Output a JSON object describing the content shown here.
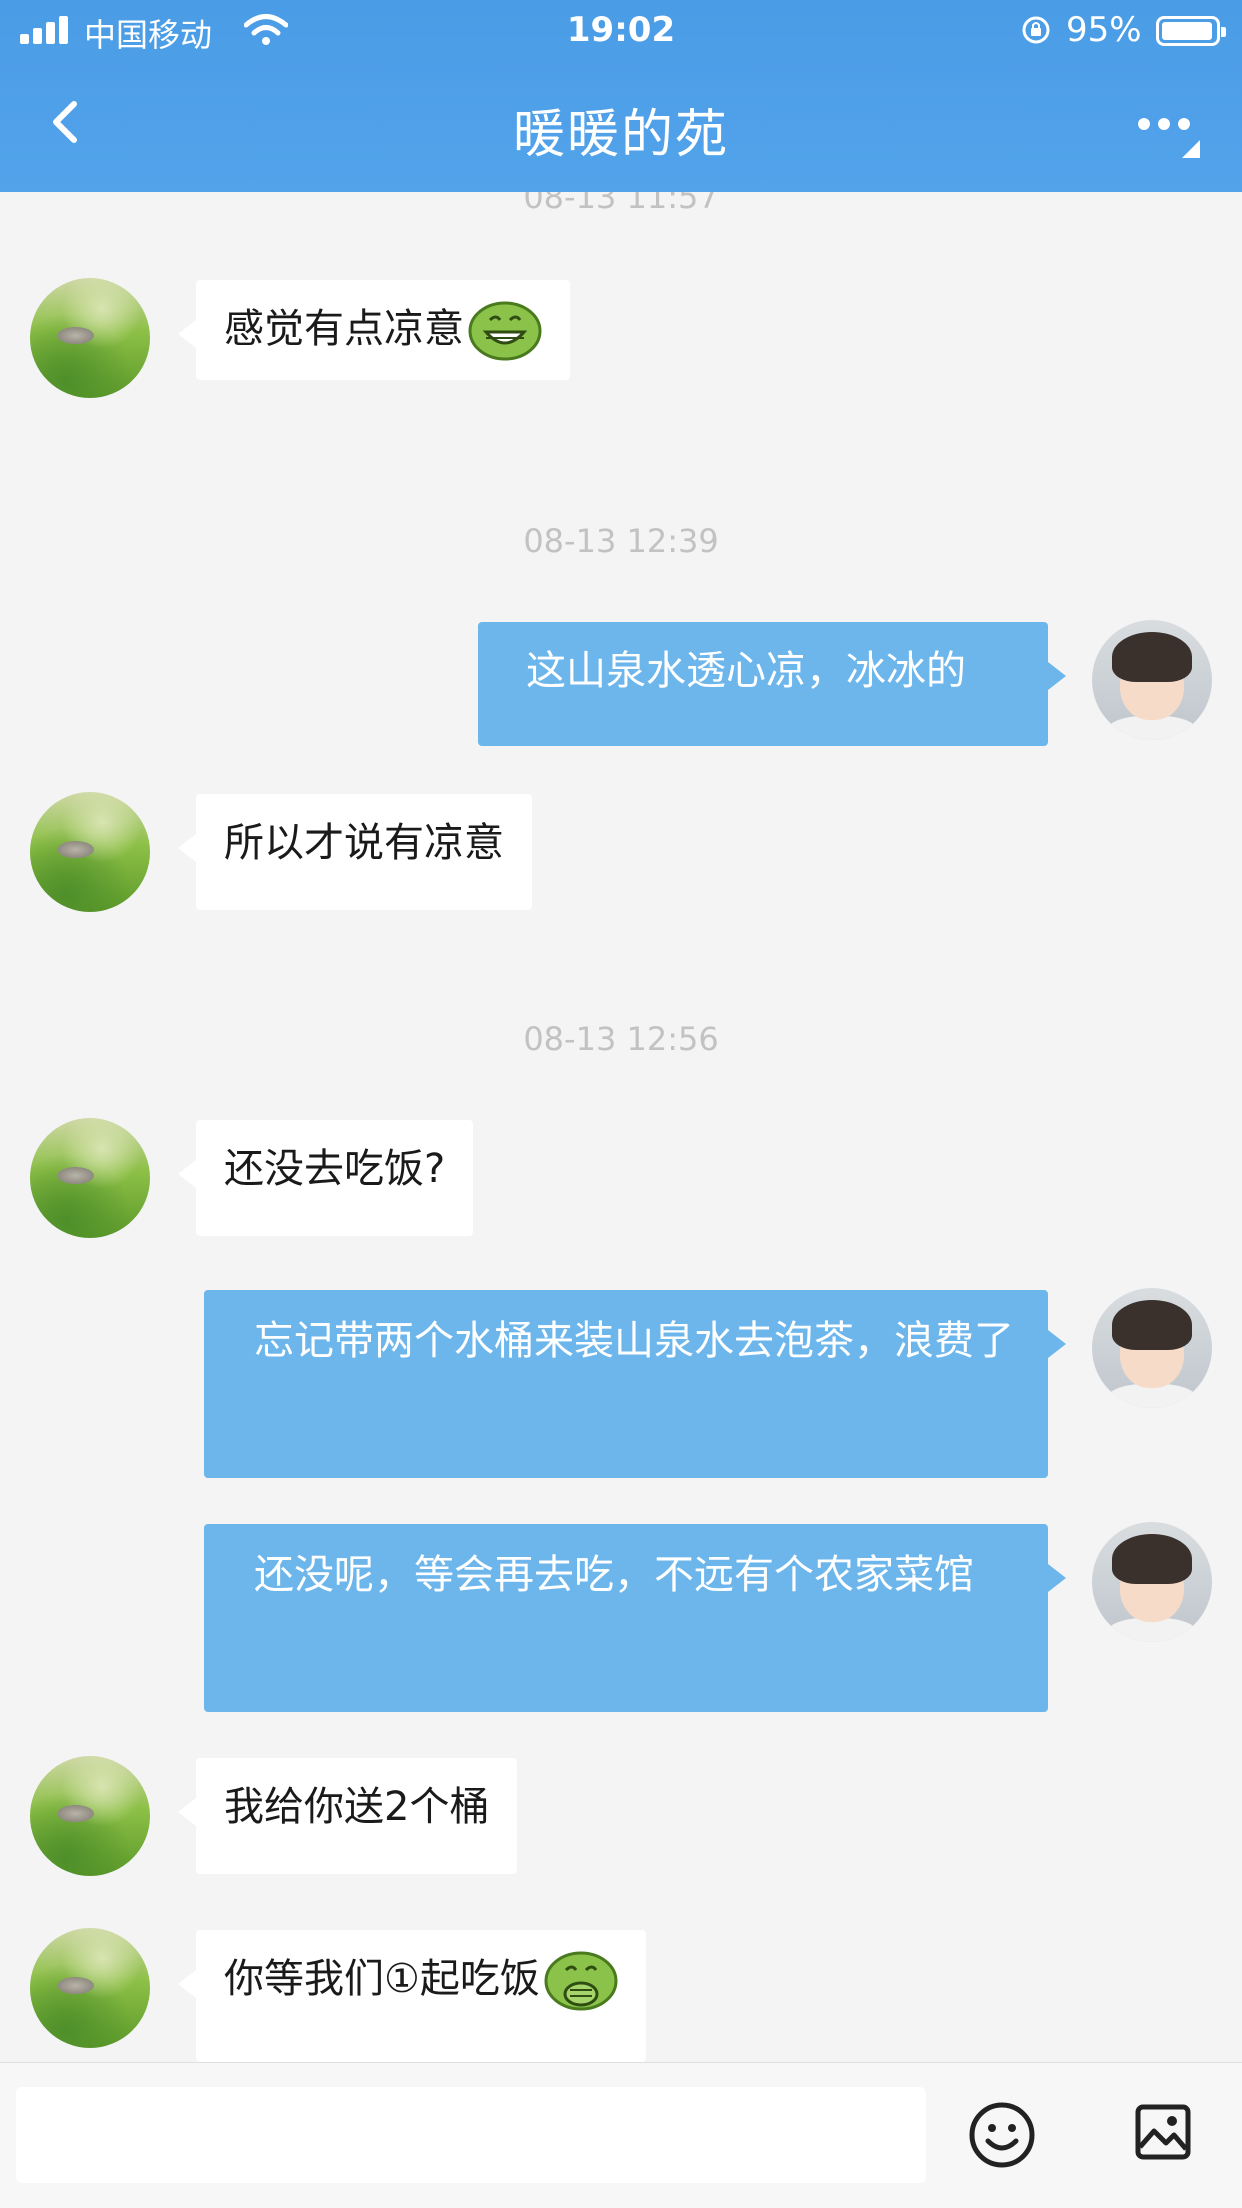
{
  "status_bar": {
    "carrier": "中国移动",
    "time": "19:02",
    "battery": "95%",
    "battery_level": 0.95
  },
  "header": {
    "title": "暖暖的苑",
    "back_icon": "chevron-left-icon",
    "more_icon": "more-icon"
  },
  "chat": {
    "partial_timestamp": "08-13 11:57",
    "timestamps": [
      "08-13 12:39",
      "08-13 12:56"
    ],
    "messages": [
      {
        "from": "other",
        "text": "感觉有点凉意",
        "emoji": "grin-emoji-icon"
      },
      {
        "from": "me",
        "text": "这山泉水透心凉，冰冰的"
      },
      {
        "from": "other",
        "text": "所以才说有凉意"
      },
      {
        "from": "other",
        "text": "还没去吃饭?"
      },
      {
        "from": "me",
        "text": "忘记带两个水桶来装山泉水去泡茶，浪费了"
      },
      {
        "from": "me",
        "text": "还没呢，等会再去吃，不远有个农家菜馆"
      },
      {
        "from": "other",
        "text": "我给你送2个桶"
      },
      {
        "from": "other",
        "text": "你等我们①起吃饭",
        "emoji": "cover-mouth-emoji-icon"
      }
    ]
  },
  "input_bar": {
    "placeholder": "",
    "emoji_icon": "smiley-icon",
    "image_icon": "image-icon"
  },
  "colors": {
    "header": "#4a9ce6",
    "outgoing_bubble": "#6db6ec",
    "incoming_bubble": "#ffffff",
    "background": "#f4f4f4"
  }
}
